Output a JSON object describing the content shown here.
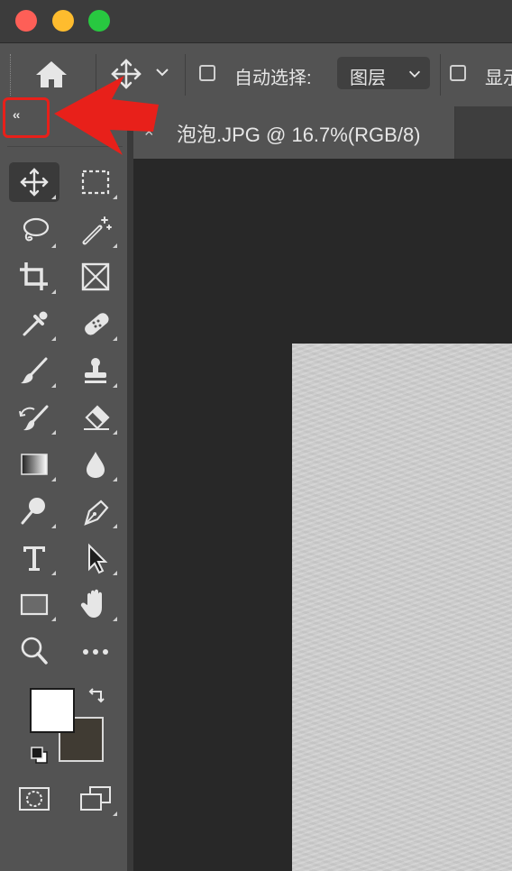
{
  "options_bar": {
    "auto_select_label": "自动选择:",
    "auto_select_value": "图层",
    "show_label": "显示"
  },
  "toolbar": {
    "collapse_label": "‹‹",
    "foreground_color": "#ffffff",
    "background_color": "#403b33"
  },
  "document_tab": {
    "close_label": "×",
    "title": "泡泡.JPG @ 16.7%(RGB/8)"
  },
  "annotation": {
    "arrow_color": "#e8201a"
  }
}
